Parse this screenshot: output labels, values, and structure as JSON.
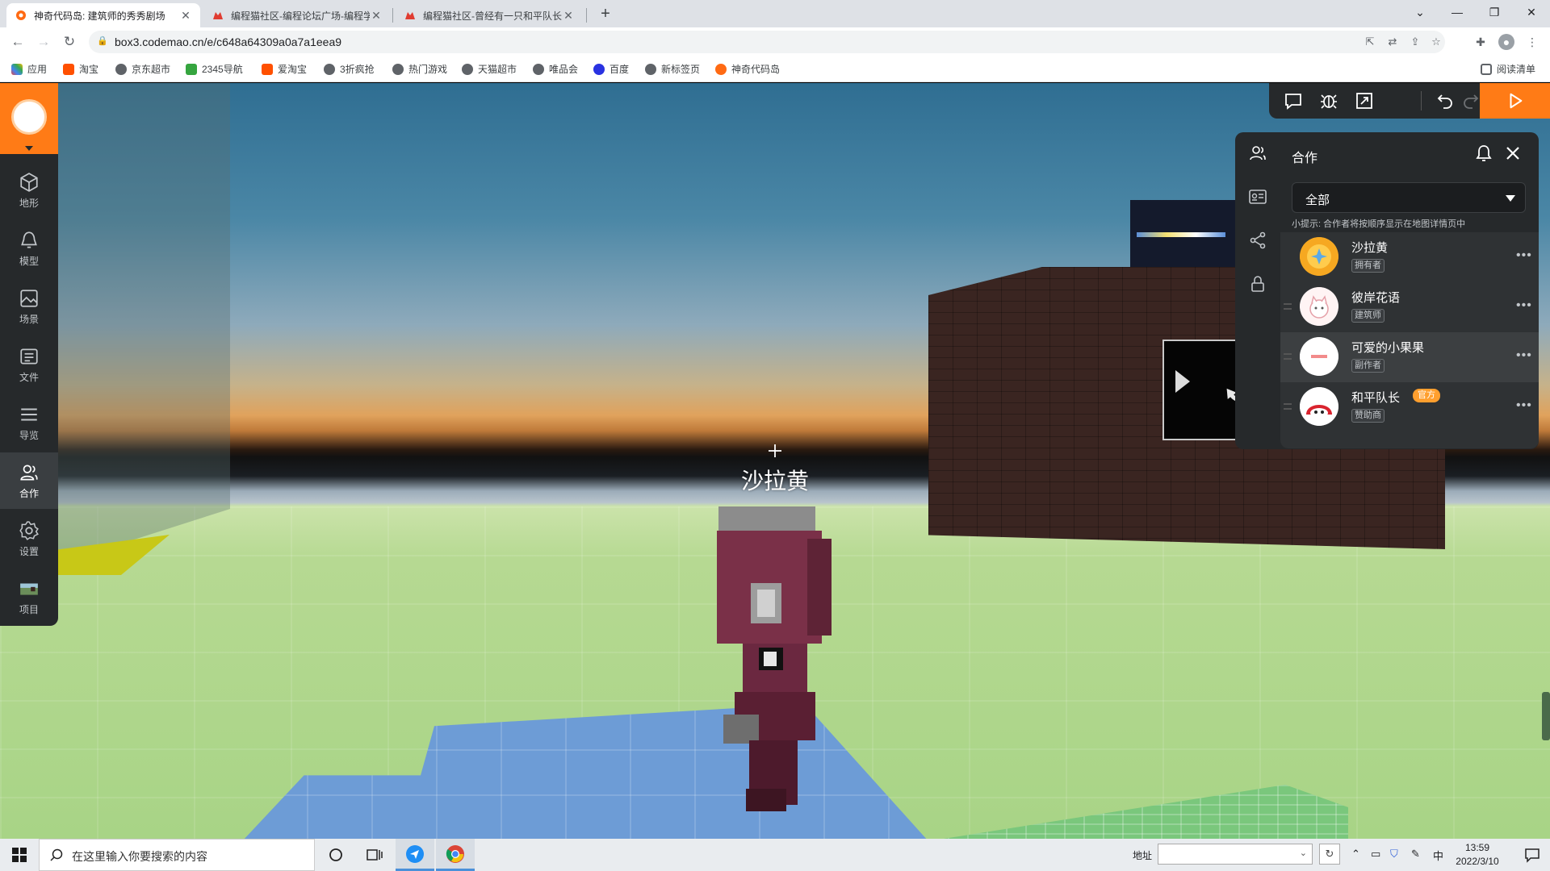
{
  "browser": {
    "tabs": [
      {
        "title": "神奇代码岛: 建筑师的秀秀剧场",
        "active": true,
        "favicon": "codemao-island-icon"
      },
      {
        "title": "编程猫社区-编程论坛广场-编程学",
        "active": false,
        "favicon": "codemao-cat-icon"
      },
      {
        "title": "编程猫社区-曾经有一只和平队长",
        "active": false,
        "favicon": "codemao-cat-icon"
      }
    ],
    "new_tab": "+",
    "url": "box3.codemao.cn/e/c648a64309a0a7a1eea9",
    "bookmarks": [
      {
        "label": "应用",
        "color": "#e8453c"
      },
      {
        "label": "淘宝",
        "color": "#ff5000"
      },
      {
        "label": "京东超市",
        "color": "#5f6368"
      },
      {
        "label": "2345导航",
        "color": "#35a53f"
      },
      {
        "label": "爱淘宝",
        "color": "#ff5000"
      },
      {
        "label": "3折疯抢",
        "color": "#5f6368"
      },
      {
        "label": "热门游戏",
        "color": "#5f6368"
      },
      {
        "label": "天猫超市",
        "color": "#5f6368"
      },
      {
        "label": "唯品会",
        "color": "#5f6368"
      },
      {
        "label": "百度",
        "color": "#2932e1"
      },
      {
        "label": "新标签页",
        "color": "#5f6368"
      },
      {
        "label": "神奇代码岛",
        "color": "#ff6a13"
      }
    ],
    "reading_list": "阅读清单"
  },
  "app": {
    "accent": "#ff7b16",
    "sidebar": [
      {
        "label": "地形",
        "icon": "cube-icon"
      },
      {
        "label": "模型",
        "icon": "bell-shape-icon"
      },
      {
        "label": "场景",
        "icon": "image-icon"
      },
      {
        "label": "文件",
        "icon": "file-icon"
      },
      {
        "label": "导览",
        "icon": "list-icon"
      },
      {
        "label": "合作",
        "icon": "users-icon",
        "active": true
      },
      {
        "label": "设置",
        "icon": "gear-icon"
      },
      {
        "label": "项目",
        "icon": "project-thumbnail-icon"
      }
    ],
    "player_name": "沙拉黄",
    "collab": {
      "title": "合作",
      "filter_value": "全部",
      "tip": "小提示: 合作者将按顺序显示在地图详情页中",
      "members": [
        {
          "name": "沙拉黄",
          "role": "拥有者",
          "official": "",
          "highlight": false
        },
        {
          "name": "彼岸花语",
          "role": "建筑师",
          "official": "",
          "highlight": false
        },
        {
          "name": "可爱的小果果",
          "role": "副作者",
          "official": "",
          "highlight": true
        },
        {
          "name": "和平队长",
          "role": "赞助商",
          "official": "官方",
          "highlight": false
        }
      ]
    }
  },
  "taskbar": {
    "search_placeholder": "在这里输入你要搜索的内容",
    "address_label": "地址",
    "ime": "中",
    "time": "13:59",
    "date": "2022/3/10"
  }
}
